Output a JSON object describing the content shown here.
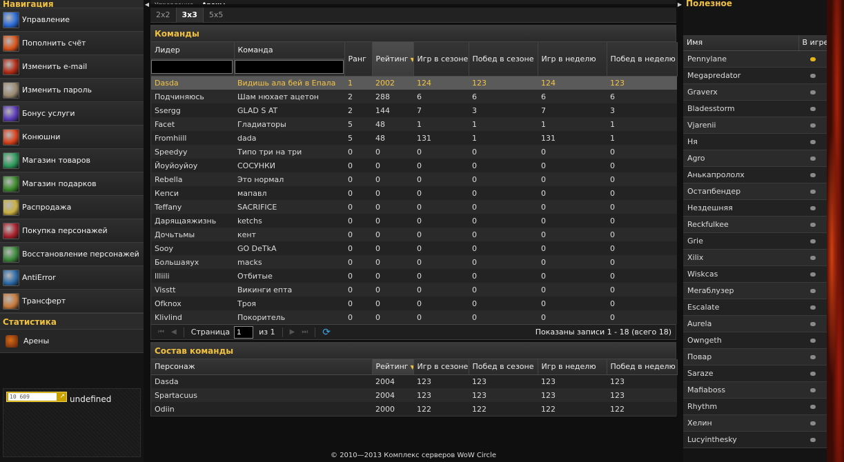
{
  "left": {
    "nav_title": "Навигация",
    "nav_items": [
      {
        "label": "Управление",
        "icon": "control-icon",
        "color": "#2a6bd8"
      },
      {
        "label": "Пополнить счёт",
        "icon": "coin-icon",
        "color": "#d8531a"
      },
      {
        "label": "Изменить e-mail",
        "icon": "mail-icon",
        "color": "#b22a14"
      },
      {
        "label": "Изменить пароль",
        "icon": "key-icon",
        "color": "#9a8a70"
      },
      {
        "label": "Бонус услуги",
        "icon": "bonus-icon",
        "color": "#5a3ab8"
      },
      {
        "label": "Конюшни",
        "icon": "stable-icon",
        "color": "#d8401a"
      },
      {
        "label": "Магазин товаров",
        "icon": "shop-icon",
        "color": "#2a9a5a"
      },
      {
        "label": "Магазин подарков",
        "icon": "gift-icon",
        "color": "#3a8a2a"
      },
      {
        "label": "Распродажа",
        "icon": "sale-icon",
        "color": "#c8b040"
      },
      {
        "label": "Покупка персонажей",
        "icon": "buy-character-icon",
        "color": "#a8202a"
      },
      {
        "label": "Восстановление персонажей",
        "icon": "restore-character-icon",
        "color": "#3a8a3a"
      },
      {
        "label": "AntiError",
        "icon": "vortex-icon",
        "color": "#2a6aa8"
      },
      {
        "label": "Трансферт",
        "icon": "transfer-icon",
        "color": "#c87a3a"
      }
    ],
    "stats_title": "Статистика",
    "stats_items": [
      {
        "label": "Арены",
        "icon": "arena-icon"
      }
    ],
    "counter": {
      "value": "10 609",
      "text": "undefined"
    }
  },
  "center": {
    "top_tabs": [
      {
        "label": "Управление",
        "active": false
      },
      {
        "label": "Арены",
        "active": true
      }
    ],
    "sub_tabs": [
      {
        "label": "2x2",
        "active": false
      },
      {
        "label": "3x3",
        "active": true
      },
      {
        "label": "5x5",
        "active": false
      }
    ],
    "teams": {
      "title": "Команды",
      "columns": [
        "Лидер",
        "Команда",
        "Ранг",
        "Рейтинг",
        "Игр в сезоне",
        "Побед в сезоне",
        "Игр в неделю",
        "Побед в неделю"
      ],
      "rows": [
        [
          "Dasda",
          "Видишь ала бей в Епала",
          "1",
          "2002",
          "124",
          "123",
          "124",
          "123"
        ],
        [
          "Подчиняюсь",
          "Шам нюхает ацетон",
          "2",
          "288",
          "6",
          "6",
          "6",
          "6"
        ],
        [
          "Ssergg",
          "GLAD S AT",
          "2",
          "144",
          "7",
          "3",
          "7",
          "3"
        ],
        [
          "Facet",
          "Гладиаторы",
          "5",
          "48",
          "1",
          "1",
          "1",
          "1"
        ],
        [
          "Fromhiill",
          "dada",
          "5",
          "48",
          "131",
          "1",
          "131",
          "1"
        ],
        [
          "Speedyy",
          "Типо три на три",
          "0",
          "0",
          "0",
          "0",
          "0",
          "0"
        ],
        [
          "Йоуйоуйоу",
          "СОСУНКИ",
          "0",
          "0",
          "0",
          "0",
          "0",
          "0"
        ],
        [
          "Rebella",
          "Это нормал",
          "0",
          "0",
          "0",
          "0",
          "0",
          "0"
        ],
        [
          "Кепси",
          "мапавл",
          "0",
          "0",
          "0",
          "0",
          "0",
          "0"
        ],
        [
          "Teffany",
          "SACRIFICE",
          "0",
          "0",
          "0",
          "0",
          "0",
          "0"
        ],
        [
          "Дарящаяжизнь",
          "ketchs",
          "0",
          "0",
          "0",
          "0",
          "0",
          "0"
        ],
        [
          "Дочьтьмы",
          "кент",
          "0",
          "0",
          "0",
          "0",
          "0",
          "0"
        ],
        [
          "Sooy",
          "GO DeTkA",
          "0",
          "0",
          "0",
          "0",
          "0",
          "0"
        ],
        [
          "Большаяух",
          "macks",
          "0",
          "0",
          "0",
          "0",
          "0",
          "0"
        ],
        [
          "Illiili",
          "Отбитые",
          "0",
          "0",
          "0",
          "0",
          "0",
          "0"
        ],
        [
          "Visstt",
          "Викинги епта",
          "0",
          "0",
          "0",
          "0",
          "0",
          "0"
        ],
        [
          "Ofknox",
          "Троя",
          "0",
          "0",
          "0",
          "0",
          "0",
          "0"
        ],
        [
          "Klivlind",
          "Покоритель",
          "0",
          "0",
          "0",
          "0",
          "0",
          "0"
        ]
      ]
    },
    "pager": {
      "page_label": "Страница",
      "page": "1",
      "of_label": "из 1",
      "info": "Показаны записи 1 - 18 (всего 18)"
    },
    "roster": {
      "title": "Состав команды",
      "columns": [
        "Персонаж",
        "Рейтинг",
        "Игр в сезоне",
        "Побед в сезоне",
        "Игр в неделю",
        "Побед в неделю"
      ],
      "rows": [
        [
          "Dasda",
          "2004",
          "123",
          "123",
          "123",
          "123"
        ],
        [
          "Spartacuus",
          "2004",
          "123",
          "123",
          "123",
          "123"
        ],
        [
          "Odiin",
          "2000",
          "122",
          "122",
          "122",
          "122"
        ]
      ]
    }
  },
  "right": {
    "title": "Полезное",
    "columns": [
      "Имя",
      "В игре"
    ],
    "players": [
      {
        "name": "Pennylane",
        "online": true
      },
      {
        "name": "Megapredator",
        "online": false
      },
      {
        "name": "Graverx",
        "online": false
      },
      {
        "name": "Bladesstorm",
        "online": false
      },
      {
        "name": "Vjarenii",
        "online": false
      },
      {
        "name": "Ня",
        "online": false
      },
      {
        "name": "Agro",
        "online": false
      },
      {
        "name": "Анькапрололх",
        "online": false
      },
      {
        "name": "Остапбендер",
        "online": false
      },
      {
        "name": "Нездешняя",
        "online": false
      },
      {
        "name": "Reckfulkee",
        "online": false
      },
      {
        "name": "Grie",
        "online": false
      },
      {
        "name": "Xilix",
        "online": false
      },
      {
        "name": "Wiskcas",
        "online": false
      },
      {
        "name": "Меrаблузер",
        "online": false
      },
      {
        "name": "Escalate",
        "online": false
      },
      {
        "name": "Aurela",
        "online": false
      },
      {
        "name": "Owngeth",
        "online": false
      },
      {
        "name": "Повар",
        "online": false
      },
      {
        "name": "Saraze",
        "online": false
      },
      {
        "name": "Mafiaboss",
        "online": false
      },
      {
        "name": "Rhythm",
        "online": false
      },
      {
        "name": "Хелин",
        "online": false
      },
      {
        "name": "Lucyinthesky",
        "online": false
      }
    ]
  },
  "footer": "© 2010—2013 Комплекс серверов WoW Circle"
}
